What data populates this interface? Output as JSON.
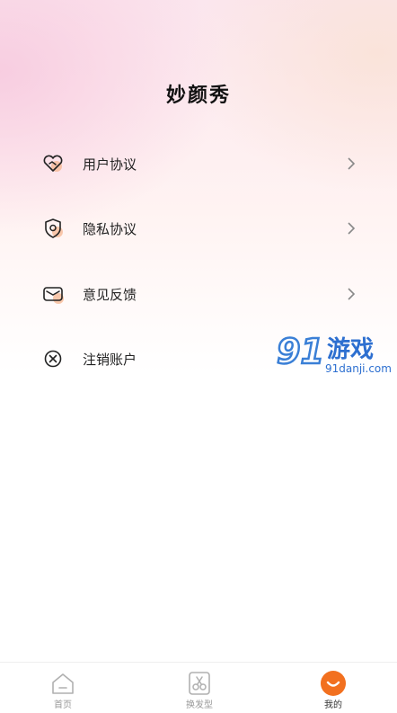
{
  "app": {
    "title": "妙颜秀"
  },
  "menu": [
    {
      "label": "用户协议",
      "icon": "heart-handshake-icon",
      "has_arrow": true
    },
    {
      "label": "隐私协议",
      "icon": "shield-icon",
      "has_arrow": true
    },
    {
      "label": "意见反馈",
      "icon": "mail-icon",
      "has_arrow": true
    },
    {
      "label": "注销账户",
      "icon": "close-circle-icon",
      "has_arrow": false
    }
  ],
  "watermark": {
    "brand": "游戏",
    "number": "91",
    "url": "91danji.com"
  },
  "tabbar": {
    "items": [
      {
        "label": "首页",
        "icon": "home-icon",
        "active": false
      },
      {
        "label": "换发型",
        "icon": "scissors-icon",
        "active": false
      },
      {
        "label": "我的",
        "icon": "smile-icon",
        "active": true
      }
    ]
  },
  "colors": {
    "accent": "#f2701f",
    "icon_highlight": "#f7b28a"
  }
}
